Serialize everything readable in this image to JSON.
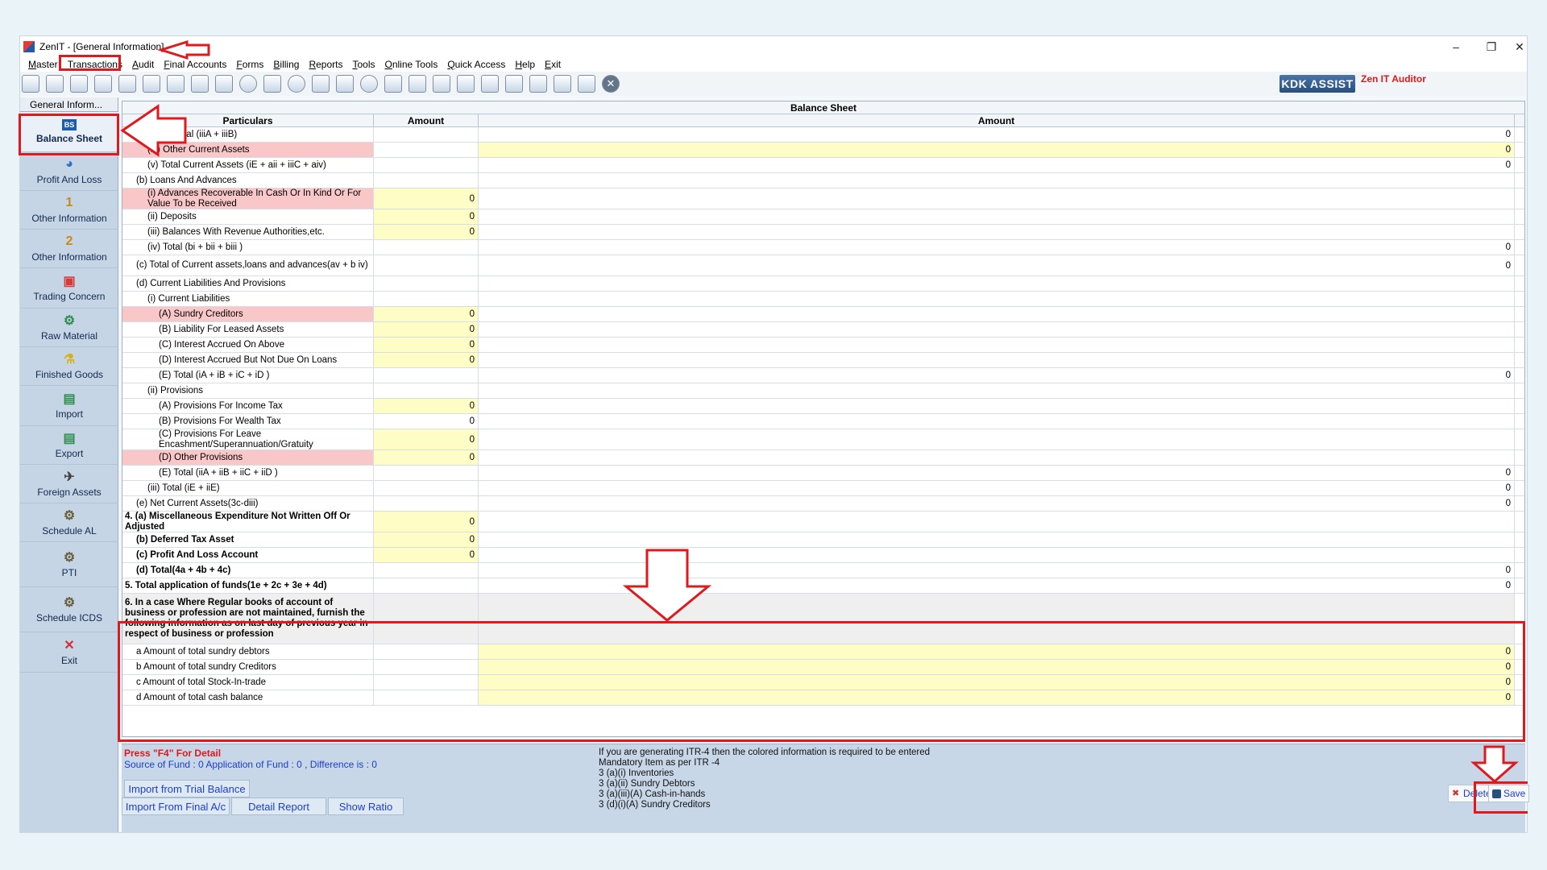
{
  "window": {
    "title": "ZenIT - [General Information]",
    "controls": [
      "–",
      "❐",
      "✕"
    ]
  },
  "menu": [
    "Master",
    "Transactions",
    "Audit",
    "Final Accounts",
    "Forms",
    "Billing",
    "Reports",
    "Tools",
    "Online Tools",
    "Quick Access",
    "Help",
    "Exit"
  ],
  "toolbar": {
    "kdk_assist": "KDK ASSIST",
    "zen_auditor": "Zen IT Auditor"
  },
  "sidebar": {
    "header": "General Inform...",
    "items": [
      {
        "label": "Balance Sheet",
        "icon": "BS",
        "color": "#1e5ba8"
      },
      {
        "label": "Profit And Loss",
        "icon": "◕",
        "color": "#2a6fd1"
      },
      {
        "label": "Other Information",
        "icon": "1",
        "color": "#c98a12"
      },
      {
        "label": "Other Information",
        "icon": "2",
        "color": "#c98a12"
      },
      {
        "label": "Trading Concern",
        "icon": "▣",
        "color": "#d83a3a"
      },
      {
        "label": "Raw Material",
        "icon": "⚙",
        "color": "#2f8f4e"
      },
      {
        "label": "Finished Goods",
        "icon": "⚗",
        "color": "#d8b012"
      },
      {
        "label": "Import",
        "icon": "▤",
        "color": "#2f8f4e"
      },
      {
        "label": "Export",
        "icon": "▤",
        "color": "#2f8f4e"
      },
      {
        "label": "Foreign Assets",
        "icon": "✈",
        "color": "#444444"
      },
      {
        "label": "Schedule AL",
        "icon": "⚙",
        "color": "#6b5e3a"
      },
      {
        "label": "PTI",
        "icon": "⚙",
        "color": "#6b5e3a"
      },
      {
        "label": "Schedule ICDS",
        "icon": "⚙",
        "color": "#6b5e3a"
      },
      {
        "label": "Exit",
        "icon": "✕",
        "color": "#d32f2f"
      }
    ]
  },
  "grid": {
    "title": "Balance Sheet",
    "headers": [
      "Particulars",
      "Amount",
      "Amount"
    ],
    "rows": [
      {
        "text": "(C) Total (iiiA + iiiB)",
        "indent": 3,
        "amt1": "",
        "amt2": "0"
      },
      {
        "text": "(iv) Other Current Assets",
        "indent": 2,
        "amt1": "",
        "amt2": "0",
        "pink": true,
        "yel2": true
      },
      {
        "text": "(v) Total Current Assets (iE + aii + iiiC + aiv)",
        "indent": 2,
        "amt1": "",
        "amt2": "0"
      },
      {
        "text": "(b) Loans And Advances",
        "indent": 1,
        "amt1": "",
        "amt2": ""
      },
      {
        "text": "(i) Advances Recoverable In Cash Or In Kind Or For Value To be Received",
        "indent": 2,
        "amt1": "0",
        "amt2": "",
        "pink": true,
        "yel1": true,
        "tall": true
      },
      {
        "text": "(ii) Deposits",
        "indent": 2,
        "amt1": "0",
        "amt2": "",
        "yel1": true
      },
      {
        "text": "(iii) Balances With Revenue Authorities,etc.",
        "indent": 2,
        "amt1": "0",
        "amt2": "",
        "yel1": true
      },
      {
        "text": "(iv) Total (bi + bii + biii )",
        "indent": 2,
        "amt1": "",
        "amt2": "0"
      },
      {
        "text": "(c) Total of Current assets,loans and advances(av + b iv)",
        "indent": 1,
        "amt1": "",
        "amt2": "0",
        "tall": true
      },
      {
        "text": "(d) Current Liabilities And Provisions",
        "indent": 1,
        "amt1": "",
        "amt2": ""
      },
      {
        "text": "(i) Current Liabilities",
        "indent": 2,
        "amt1": "",
        "amt2": ""
      },
      {
        "text": "(A) Sundry Creditors",
        "indent": 3,
        "amt1": "0",
        "amt2": "",
        "pink": true,
        "yel1": true
      },
      {
        "text": "(B) Liability For Leased Assets",
        "indent": 3,
        "amt1": "0",
        "amt2": "",
        "yel1": true
      },
      {
        "text": "(C) Interest Accrued On Above",
        "indent": 3,
        "amt1": "0",
        "amt2": "",
        "yel1": true
      },
      {
        "text": "(D) Interest Accrued But Not Due On Loans",
        "indent": 3,
        "amt1": "0",
        "amt2": "",
        "yel1": true
      },
      {
        "text": "(E) Total (iA + iB + iC + iD )",
        "indent": 3,
        "amt1": "",
        "amt2": "0"
      },
      {
        "text": "(ii) Provisions",
        "indent": 2,
        "amt1": "",
        "amt2": ""
      },
      {
        "text": "(A) Provisions For Income Tax",
        "indent": 3,
        "amt1": "0",
        "amt2": "",
        "yel1": true
      },
      {
        "text": "(B) Provisions For Wealth Tax",
        "indent": 3,
        "amt1": "0",
        "amt2": ""
      },
      {
        "text": "(C) Provisions For Leave Encashment/Superannuation/Gratuity",
        "indent": 3,
        "amt1": "0",
        "amt2": "",
        "yel1": true,
        "tall": true
      },
      {
        "text": "(D) Other Provisions",
        "indent": 3,
        "amt1": "0",
        "amt2": "",
        "pink": true,
        "yel1": true
      },
      {
        "text": "(E) Total (iiA + iiB + iiC + iiD )",
        "indent": 3,
        "amt1": "",
        "amt2": "0"
      },
      {
        "text": "(iii) Total (iE + iiE)",
        "indent": 2,
        "amt1": "",
        "amt2": "0"
      },
      {
        "text": "(e) Net Current Assets(3c-diii)",
        "indent": 1,
        "amt1": "",
        "amt2": "0"
      },
      {
        "text": "4. (a) Miscellaneous Expenditure Not Written Off Or Adjusted",
        "indent": 0,
        "amt1": "0",
        "amt2": "",
        "bold": true,
        "yel1": true,
        "tall": true
      },
      {
        "text": "(b) Deferred Tax Asset",
        "indent": 1,
        "amt1": "0",
        "amt2": "",
        "bold": true,
        "yel1": true
      },
      {
        "text": "(c) Profit And Loss Account",
        "indent": 1,
        "amt1": "0",
        "amt2": "",
        "bold": true,
        "yel1": true
      },
      {
        "text": "(d) Total(4a + 4b + 4c)",
        "indent": 1,
        "amt1": "",
        "amt2": "0",
        "bold": true
      },
      {
        "text": "5. Total application of funds(1e + 2c + 3e + 4d)",
        "indent": 0,
        "amt1": "",
        "amt2": "0",
        "bold": true
      },
      {
        "text": "6. In a case Where Regular books of account of business or profession are not maintained, furnish the following information as on last day of previous year in respect of business or profession",
        "indent": 0,
        "amt1": "",
        "amt2": "",
        "bold": true,
        "gray": true,
        "xtall": true
      },
      {
        "text": "a Amount of total sundry debtors",
        "indent": 1,
        "amt1": "",
        "amt2": "0",
        "yel2": true
      },
      {
        "text": "b Amount of total sundry Creditors",
        "indent": 1,
        "amt1": "",
        "amt2": "0",
        "yel2": true
      },
      {
        "text": "c Amount of total Stock-In-trade",
        "indent": 1,
        "amt1": "",
        "amt2": "0",
        "yel2": true
      },
      {
        "text": "d Amount of total cash balance",
        "indent": 1,
        "amt1": "",
        "amt2": "0",
        "yel2": true
      }
    ]
  },
  "bottom": {
    "press_f4": "Press \"F4\" For Detail",
    "fund_line": "Source of Fund : 0 Application of Fund : 0 , Difference is : 0",
    "info": "If you are generating ITR-4 then the colored information is required to be entered\nMandatory Item as per ITR -4\n3 (a)(i) Inventories\n3 (a)(ii) Sundry Debtors\n3 (a)(iii)(A) Cash-in-hands\n3 (d)(i)(A) Sundry Creditors",
    "import_trial": "Import from Trial Balance",
    "import_final": "Import From Final A/c",
    "detail_report": "Detail Report",
    "show_ratio": "Show Ratio",
    "delete": "Delete",
    "save": "Save"
  },
  "colors": {
    "annotation": "#e0191e",
    "highlight_red": "#f9c7c8",
    "highlight_yellow": "#fffdc6"
  }
}
